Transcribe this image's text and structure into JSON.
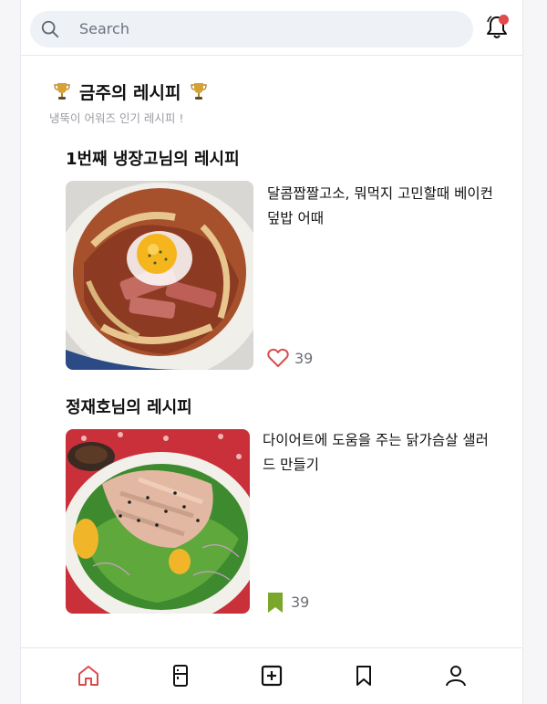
{
  "search": {
    "placeholder": "Search"
  },
  "section": {
    "title": "금주의 레시피",
    "subtitle": "냉뚝이 어워즈 인기 레시피 !"
  },
  "recipes": [
    {
      "author_title": "1번째 냉장고님의 레시피",
      "description": "달콤짭짤고소, 뭐먹지 고민할때 베이컨 덮밥 어때",
      "count": "39",
      "action_icon": "heart-outline-icon"
    },
    {
      "author_title": "정재호님의 레시피",
      "description": "다이어트에 도움을 주는 닭가슴살 샐러드 만들기",
      "count": "39",
      "action_icon": "bookmark-filled-icon"
    }
  ],
  "nav": {
    "items": [
      "home-icon",
      "fridge-icon",
      "add-icon",
      "bookmark-icon",
      "profile-icon"
    ],
    "active_color": "#d94c4c"
  },
  "colors": {
    "accent": "#d94c4c",
    "bookmark": "#7aa62a"
  }
}
